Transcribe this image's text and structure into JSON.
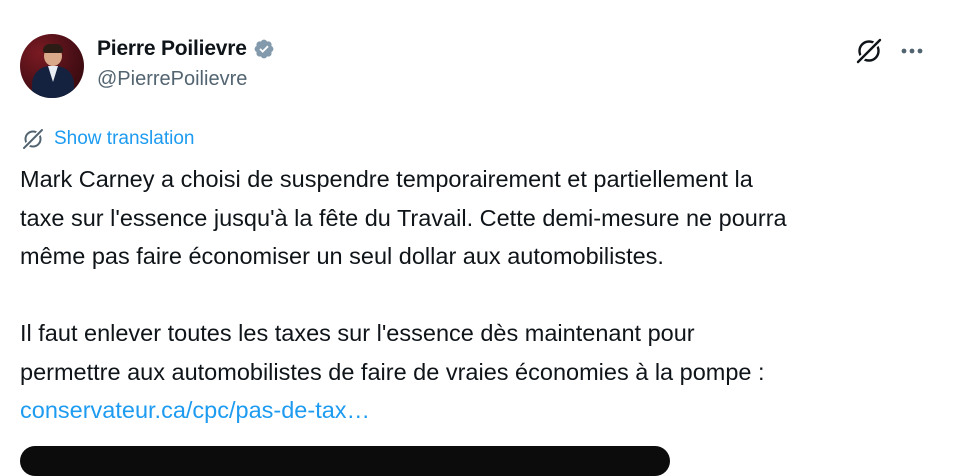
{
  "author": {
    "display_name": "Pierre Poilievre",
    "handle": "@PierrePoilievre",
    "verified_icon": "verified-badge-grey"
  },
  "actions": {
    "grok_icon": "grok-slash-icon",
    "more_icon": "more-horizontal-icon"
  },
  "translation": {
    "label": "Show translation",
    "icon": "translate-globe-icon"
  },
  "post": {
    "lines": [
      "Mark Carney a choisi de suspendre temporairement et partiellement la",
      "taxe sur l'essence jusqu'à la fête du Travail. Cette demi-mesure ne pourra",
      "même pas faire économiser un seul dollar aux automobilistes.",
      "Il faut enlever toutes les taxes sur l'essence dès maintenant pour",
      "permettre aux automobilistes de faire de vraies économies à la pompe :"
    ],
    "link": "conservateur.ca/cpc/pas-de-tax…"
  },
  "colors": {
    "text": "#0f1419",
    "secondary": "#536471",
    "link": "#1d9bf0",
    "verified": "#829aab"
  }
}
